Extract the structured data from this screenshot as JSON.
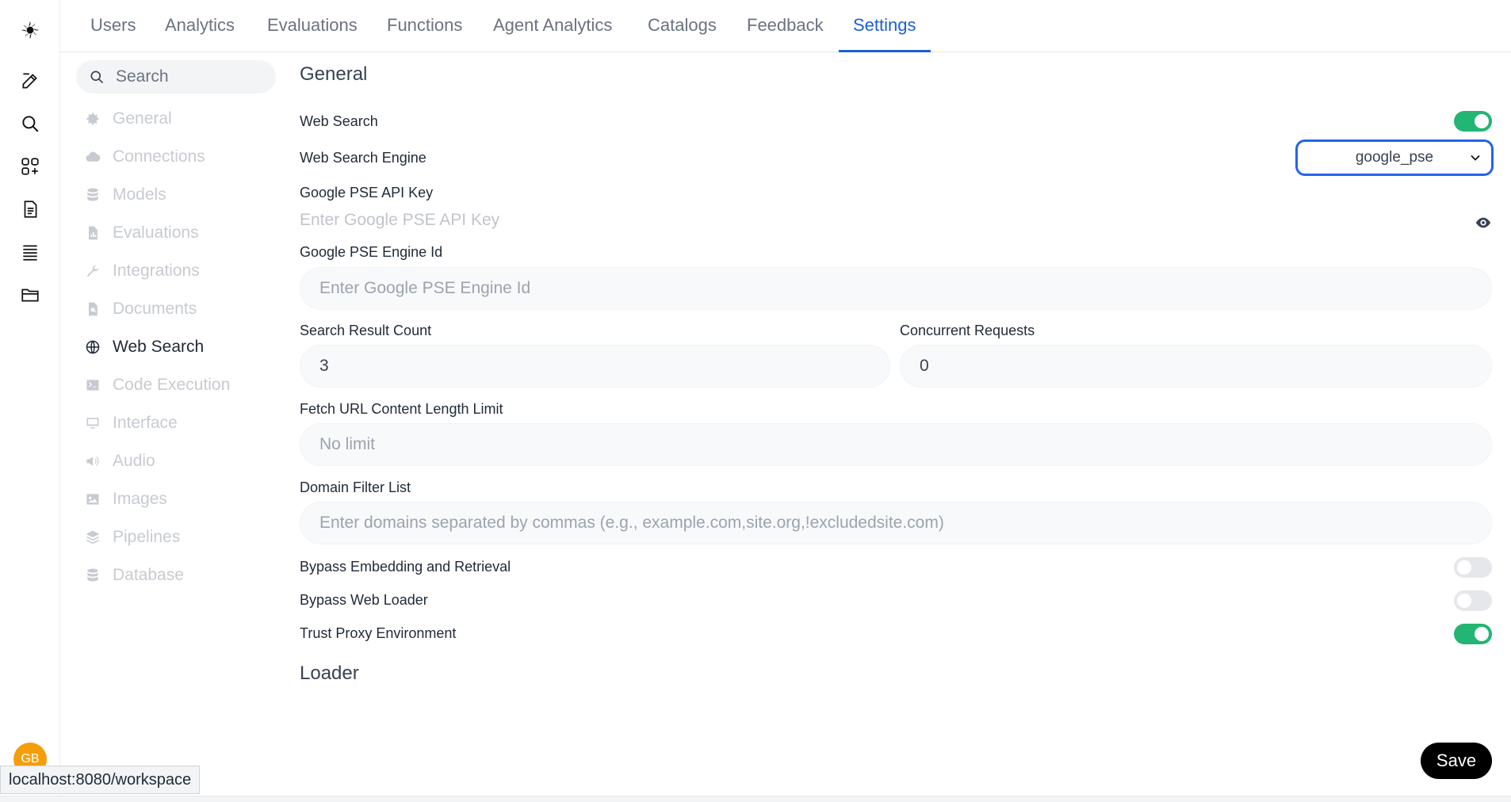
{
  "rail": {
    "icons": [
      "logo-icon",
      "edit-icon",
      "search-icon",
      "apps-icon",
      "notes-icon",
      "list-icon",
      "folder-icon"
    ],
    "avatar_initials": "GB"
  },
  "tabs": [
    {
      "label": "Users"
    },
    {
      "label": "Analytics"
    },
    {
      "label": "Evaluations"
    },
    {
      "label": "Functions"
    },
    {
      "label": "Agent Analytics"
    },
    {
      "label": "Catalogs"
    },
    {
      "label": "Feedback"
    },
    {
      "label": "Settings",
      "active": true
    }
  ],
  "sidebar": {
    "search_placeholder": "Search",
    "items": [
      {
        "label": "General",
        "icon": "gear-icon"
      },
      {
        "label": "Connections",
        "icon": "cloud-icon"
      },
      {
        "label": "Models",
        "icon": "database-icon"
      },
      {
        "label": "Evaluations",
        "icon": "document-chart-icon"
      },
      {
        "label": "Integrations",
        "icon": "wrench-icon"
      },
      {
        "label": "Documents",
        "icon": "document-search-icon"
      },
      {
        "label": "Web Search",
        "icon": "globe-icon",
        "active": true
      },
      {
        "label": "Code Execution",
        "icon": "terminal-icon"
      },
      {
        "label": "Interface",
        "icon": "monitor-icon"
      },
      {
        "label": "Audio",
        "icon": "speaker-icon"
      },
      {
        "label": "Images",
        "icon": "image-icon"
      },
      {
        "label": "Pipelines",
        "icon": "layers-icon"
      },
      {
        "label": "Database",
        "icon": "database-icon"
      }
    ]
  },
  "main": {
    "section_general": "General",
    "web_search_label": "Web Search",
    "web_search_on": true,
    "engine_label": "Web Search Engine",
    "engine_value": "google_pse",
    "api_key_label": "Google PSE API Key",
    "api_key_placeholder": "Enter Google PSE API Key",
    "engine_id_label": "Google PSE Engine Id",
    "engine_id_placeholder": "Enter Google PSE Engine Id",
    "result_count_label": "Search Result Count",
    "result_count_value": "3",
    "concurrent_label": "Concurrent Requests",
    "concurrent_value": "0",
    "fetch_limit_label": "Fetch URL Content Length Limit",
    "fetch_limit_placeholder": "No limit",
    "domain_filter_label": "Domain Filter List",
    "domain_filter_placeholder": "Enter domains separated by commas (e.g., example.com,site.org,!excludedsite.com)",
    "bypass_embedding_label": "Bypass Embedding and Retrieval",
    "bypass_embedding_on": false,
    "bypass_loader_label": "Bypass Web Loader",
    "bypass_loader_on": false,
    "trust_proxy_label": "Trust Proxy Environment",
    "trust_proxy_on": true,
    "section_loader": "Loader",
    "save_label": "Save"
  },
  "statusbar": {
    "url": "localhost:8080/workspace"
  },
  "colors": {
    "accent": "#1d5fd1",
    "toggle_on": "#22b573",
    "avatar": "#f59e0b"
  }
}
